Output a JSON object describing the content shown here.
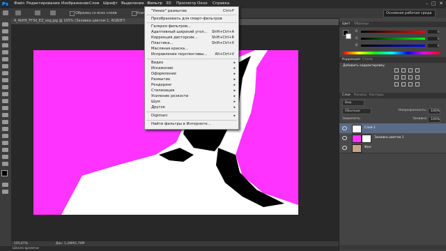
{
  "app": {
    "logo": "Ps",
    "menu": [
      "Файл",
      "Редактирование",
      "Изображение",
      "Слои",
      "Шрифт",
      "Выделение",
      "Фильтр",
      "3D",
      "Просмотр",
      "Окно",
      "Справка"
    ]
  },
  "options_bar": {
    "sample_all_layers": "Образец со всех слоев",
    "auto_enhance": "Усилить автоматически",
    "workspace": "Основная рабочая среда"
  },
  "document": {
    "tab": "4_4kH9_FF3d_EZ_seg.jpg @ 105% (Заливка цветом 1, RGB/8*)",
    "zoom": "105,67%",
    "doc_size": "Док: 1,28M/1,70M"
  },
  "filter_menu": {
    "items": [
      {
        "label": "\"Умное\" размытие",
        "shortcut": "Ctrl+F"
      },
      {
        "label": "Преобразовать для смарт-фильтров",
        "shortcut": ""
      },
      {
        "label": "Галерея фильтров...",
        "shortcut": ""
      },
      {
        "label": "Адаптивный широкий угол...",
        "shortcut": "Shift+Ctrl+A"
      },
      {
        "label": "Коррекция дисторсии...",
        "shortcut": "Shift+Ctrl+R"
      },
      {
        "label": "Пластика...",
        "shortcut": "Shift+Ctrl+X"
      },
      {
        "label": "Масляная краска...",
        "shortcut": ""
      },
      {
        "label": "Исправление перспективы...",
        "shortcut": "Alt+Ctrl+V"
      },
      {
        "label": "Видео",
        "shortcut": ""
      },
      {
        "label": "Искажение",
        "shortcut": ""
      },
      {
        "label": "Оформление",
        "shortcut": ""
      },
      {
        "label": "Размытие",
        "shortcut": ""
      },
      {
        "label": "Рендеринг",
        "shortcut": ""
      },
      {
        "label": "Стилизация",
        "shortcut": ""
      },
      {
        "label": "Усиление резкости",
        "shortcut": ""
      },
      {
        "label": "Шум",
        "shortcut": ""
      },
      {
        "label": "Другое",
        "shortcut": ""
      },
      {
        "label": "Digimarc",
        "shortcut": ""
      },
      {
        "label": "Найти фильтры в Интернете...",
        "shortcut": ""
      }
    ]
  },
  "panels": {
    "color_tabs": [
      "Цвет",
      "Образцы"
    ],
    "color_values": [
      "0",
      "0",
      "0"
    ],
    "adjust_tabs": [
      "Коррекция",
      "Стили"
    ],
    "adjust_title": "Добавить корректировку",
    "layers_tabs": [
      "Слои",
      "Каналы",
      "Контуры"
    ],
    "filter_kind": "Вид",
    "blend_mode": "Обычные",
    "opacity_label": "Непрозрачность:",
    "opacity_value": "100%",
    "lock_label": "Закрепить:",
    "fill_label": "Заливка:",
    "fill_value": "100%",
    "layers": [
      {
        "name": "Слой 1"
      },
      {
        "name": "Заливка цветом 1"
      },
      {
        "name": "Фон"
      }
    ]
  },
  "status": {
    "mini_bridge": "Шкала времени"
  },
  "colors": {
    "magenta": "#ff33ff",
    "menu_bg": "#f0f0f0",
    "panel_bg": "#444444",
    "accent": "#33a5ff"
  }
}
